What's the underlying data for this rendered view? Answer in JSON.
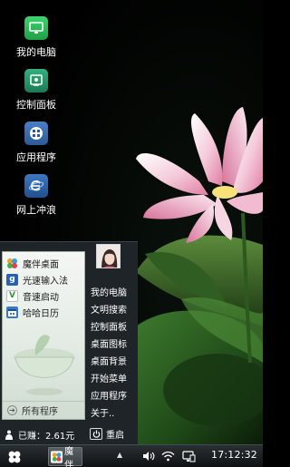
{
  "desktop": {
    "icons": [
      {
        "label": "我的电脑",
        "icon": "computer-icon"
      },
      {
        "label": "控制面板",
        "icon": "control-panel-icon"
      },
      {
        "label": "应用程序",
        "icon": "apps-icon"
      },
      {
        "label": "网上冲浪",
        "icon": "browser-icon"
      }
    ]
  },
  "start_menu": {
    "pinned": [
      {
        "label": "魔伴桌面",
        "icon": "moban-desktop-icon"
      },
      {
        "label": "光速输入法",
        "icon": "input-method-icon"
      },
      {
        "label": "音速启动",
        "icon": "launcher-icon"
      },
      {
        "label": "哈哈日历",
        "icon": "calendar-icon"
      }
    ],
    "all_programs": "所有程序",
    "links": [
      "我的电脑",
      "文明搜索",
      "控制面板",
      "桌面图标",
      "桌面背景",
      "开始菜单",
      "应用程序",
      "关于.."
    ],
    "earned": "已赚：2.61元",
    "restart": "重启"
  },
  "taskbar": {
    "app_label": "魔伴",
    "clock": "17:12:32"
  },
  "colors": {
    "icon_green": "#2fbf5a",
    "icon_teal": "#1f8f6a",
    "icon_blue": "#2f6fb0",
    "taskbar_dark": "#0f1215"
  }
}
